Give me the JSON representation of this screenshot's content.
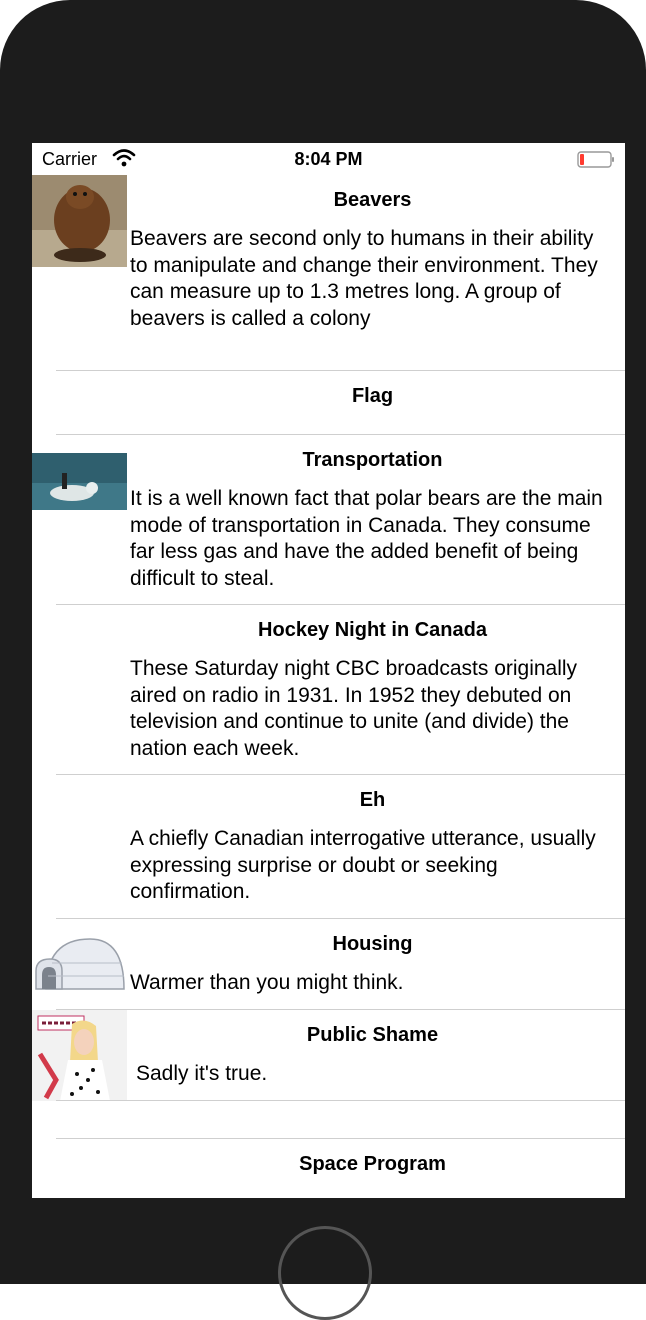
{
  "status_bar": {
    "carrier": "Carrier",
    "time": "8:04 PM",
    "battery_color": "#ff3b30"
  },
  "rows": [
    {
      "title": "Beavers",
      "body": "Beavers are second only to humans in their ability to manipulate and change their environment. They can measure up to 1.3 metres long. A group of beavers is called a colony",
      "thumbnail": "beaver"
    },
    {
      "title": "Flag",
      "body": "",
      "thumbnail": ""
    },
    {
      "title": "Transportation",
      "body": "It is a well known fact that polar bears are the main mode of transportation in Canada. They consume far less gas and have the added benefit of being difficult to steal.",
      "thumbnail": "polar-bear"
    },
    {
      "title": "Hockey Night in Canada",
      "body": "These Saturday night CBC broadcasts originally aired on radio in 1931. In 1952 they debuted on television and continue to unite (and divide) the nation each week.",
      "thumbnail": ""
    },
    {
      "title": "Eh",
      "body": "A chiefly Canadian interrogative utterance, usually expressing surprise or doubt or seeking confirmation.",
      "thumbnail": ""
    },
    {
      "title": "Housing",
      "body": "Warmer than you might think.",
      "thumbnail": "igloo"
    },
    {
      "title": "Public Shame",
      "body": "Sadly it's true.",
      "thumbnail": "album-cover"
    },
    {
      "title": "",
      "body": "",
      "thumbnail": ""
    },
    {
      "title": "Space Program",
      "body": "",
      "thumbnail": ""
    }
  ]
}
